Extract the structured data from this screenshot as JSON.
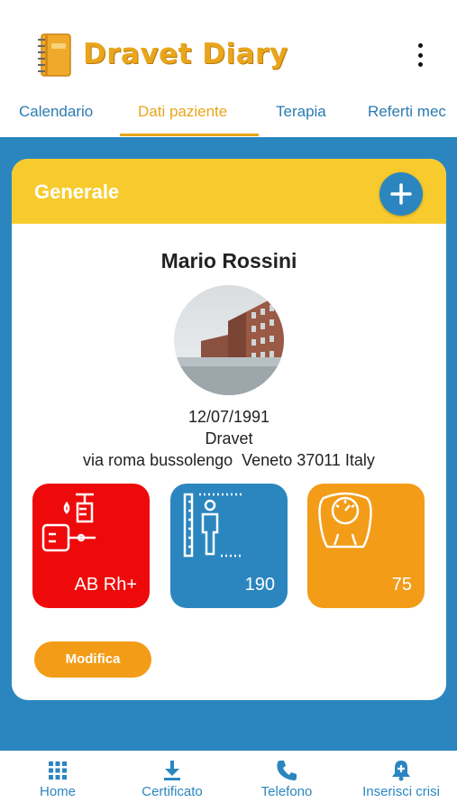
{
  "app": {
    "title": "Dravet Diary"
  },
  "tabs": [
    {
      "label": "Calendario"
    },
    {
      "label": "Dati paziente"
    },
    {
      "label": "Terapia"
    },
    {
      "label": "Referti mec"
    }
  ],
  "card": {
    "title": "Generale",
    "patient": {
      "name": "Mario Rossini",
      "birth_date": "12/07/1991",
      "condition": "Dravet",
      "address": "via roma bussolengo  Veneto 37011 Italy"
    },
    "tiles": {
      "blood_type": "AB Rh+",
      "height": "190",
      "weight": "75"
    },
    "edit_label": "Modifica"
  },
  "bottom_nav": [
    {
      "label": "Home",
      "icon": "grid-icon"
    },
    {
      "label": "Certificato",
      "icon": "download-icon"
    },
    {
      "label": "Telefono",
      "icon": "phone-icon"
    },
    {
      "label": "Inserisci crisi",
      "icon": "bell-plus-icon"
    }
  ],
  "colors": {
    "primary_blue": "#2b86bf",
    "yellow": "#f7cb2e",
    "orange": "#f39c18",
    "red": "#ee0a0a",
    "accent_tab": "#e9a51b"
  }
}
